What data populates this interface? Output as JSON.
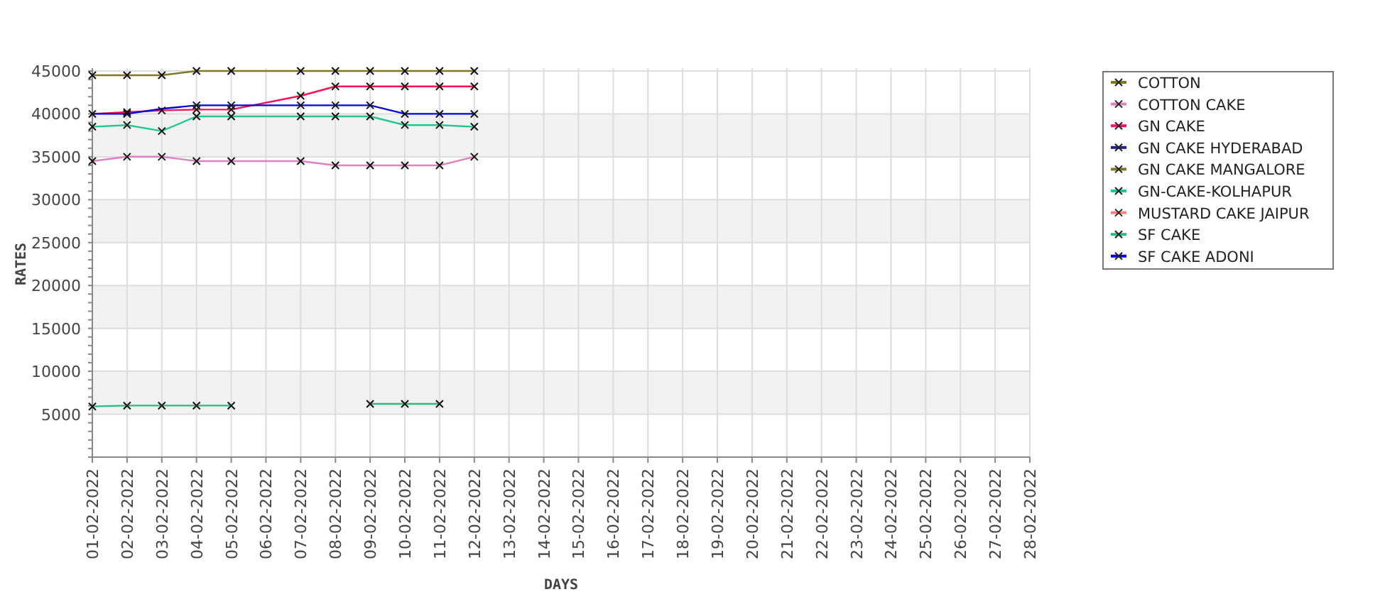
{
  "chart_data": {
    "type": "line",
    "xlabel": "DAYS",
    "ylabel": "RATES",
    "grid": true,
    "legend": true,
    "categories": [
      "01-02-2022",
      "02-02-2022",
      "03-02-2022",
      "04-02-2022",
      "05-02-2022",
      "06-02-2022",
      "07-02-2022",
      "08-02-2022",
      "09-02-2022",
      "10-02-2022",
      "11-02-2022",
      "12-02-2022",
      "13-02-2022",
      "14-02-2022",
      "15-02-2022",
      "16-02-2022",
      "17-02-2022",
      "18-02-2022",
      "19-02-2022",
      "20-02-2022",
      "21-02-2022",
      "22-02-2022",
      "23-02-2022",
      "24-02-2022",
      "25-02-2022",
      "26-02-2022",
      "27-02-2022",
      "28-02-2022"
    ],
    "ylim": [
      0,
      45300
    ],
    "yticks": [
      5000,
      10000,
      15000,
      20000,
      25000,
      30000,
      35000,
      40000,
      45000
    ],
    "series": [
      {
        "name": "COTTON",
        "color": "#807820",
        "marker": "x",
        "values": [
          44500,
          44500,
          44500,
          45000,
          45000,
          null,
          45000,
          45000,
          45000,
          45000,
          45000,
          45000,
          null,
          null,
          null,
          null,
          null,
          null,
          null,
          null,
          null,
          null,
          null,
          null,
          null,
          null,
          null,
          null
        ]
      },
      {
        "name": "COTTON CAKE",
        "color": "#e080c0",
        "marker": "x",
        "values": [
          34500,
          35000,
          35000,
          34500,
          34500,
          null,
          34500,
          34000,
          34000,
          34000,
          34000,
          35000,
          null,
          null,
          null,
          null,
          null,
          null,
          null,
          null,
          null,
          null,
          null,
          null,
          null,
          null,
          null,
          null
        ]
      },
      {
        "name": "GN CAKE",
        "color": "#ff1050",
        "marker": "x",
        "values": [
          40000,
          40200,
          40400,
          40500,
          40500,
          null,
          42100,
          43200,
          43200,
          43200,
          43200,
          43200,
          null,
          null,
          null,
          null,
          null,
          null,
          null,
          null,
          null,
          null,
          null,
          null,
          null,
          null,
          null,
          null
        ]
      },
      {
        "name": "GN CAKE HYDERABAD",
        "color": "#202090",
        "marker": "x",
        "values": [
          null,
          null,
          null,
          null,
          null,
          null,
          null,
          null,
          null,
          null,
          null,
          null,
          null,
          null,
          null,
          null,
          null,
          null,
          null,
          null,
          null,
          null,
          null,
          null,
          null,
          null,
          null,
          null
        ]
      },
      {
        "name": "GN CAKE MANGALORE",
        "color": "#807820",
        "marker": "x",
        "values": [
          null,
          null,
          null,
          null,
          null,
          null,
          null,
          null,
          null,
          null,
          null,
          null,
          null,
          null,
          null,
          null,
          null,
          null,
          null,
          null,
          null,
          null,
          null,
          null,
          null,
          null,
          null,
          null
        ]
      },
      {
        "name": "GN-CAKE-KOLHAPUR",
        "color": "#20c890",
        "marker": "x",
        "values": [
          38500,
          38700,
          38000,
          39700,
          39700,
          null,
          39700,
          39700,
          39700,
          38700,
          38700,
          38500,
          null,
          null,
          null,
          null,
          null,
          null,
          null,
          null,
          null,
          null,
          null,
          null,
          null,
          null,
          null,
          null
        ]
      },
      {
        "name": "MUSTARD CAKE JAIPUR",
        "color": "#ff8080",
        "marker": "x",
        "values": [
          null,
          null,
          null,
          null,
          null,
          null,
          null,
          null,
          null,
          null,
          null,
          null,
          null,
          null,
          null,
          null,
          null,
          null,
          null,
          null,
          null,
          null,
          null,
          null,
          null,
          null,
          null,
          null
        ]
      },
      {
        "name": "SF CAKE",
        "color": "#20c080",
        "marker": "x",
        "values": [
          5900,
          6000,
          6000,
          6000,
          6000,
          null,
          null,
          null,
          6200,
          6200,
          6200,
          null,
          null,
          null,
          null,
          null,
          null,
          null,
          null,
          null,
          null,
          null,
          null,
          null,
          null,
          null,
          null,
          null
        ]
      },
      {
        "name": "SF CAKE ADONI",
        "color": "#0000e0",
        "marker": "x",
        "values": [
          40000,
          40000,
          40600,
          41000,
          41000,
          null,
          41000,
          41000,
          41000,
          40000,
          40000,
          40000,
          null,
          null,
          null,
          null,
          null,
          null,
          null,
          null,
          null,
          null,
          null,
          null,
          null,
          null,
          null,
          null
        ]
      }
    ]
  }
}
